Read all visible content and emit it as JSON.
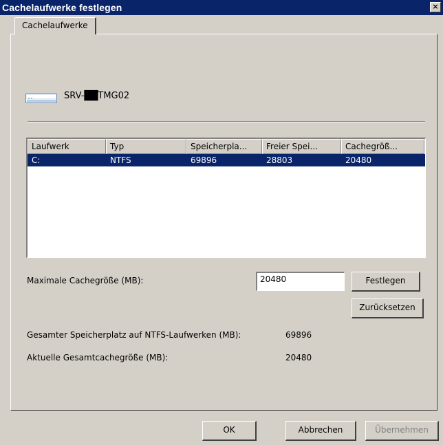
{
  "window": {
    "title": "Cachelaufwerke festlegen",
    "close_glyph": "×"
  },
  "tabs": [
    {
      "label": "Cachelaufwerke"
    }
  ],
  "server": {
    "name": "SRV-██TMG02",
    "icon": "server-icon"
  },
  "drives_table": {
    "columns": [
      "Laufwerk",
      "Typ",
      "Speicherpla...",
      "Freier Spei...",
      "Cachegröß..."
    ],
    "rows": [
      {
        "laufwerk": "C:",
        "typ": "NTFS",
        "speicherplatz": "69896",
        "freier_speicher": "28803",
        "cachegroesse": "20480",
        "selected": true
      }
    ]
  },
  "max_cache": {
    "label": "Maximale Cachegröße (MB):",
    "value": "20480",
    "set_button": "Festlegen",
    "reset_button": "Zurücksetzen"
  },
  "totals": {
    "ntfs_label": "Gesamter Speicherplatz auf NTFS-Laufwerken (MB):",
    "ntfs_value": "69896",
    "cache_label": "Aktuelle Gesamtcachegröße (MB):",
    "cache_value": "20480"
  },
  "buttons": {
    "ok": "OK",
    "cancel": "Abbrechen",
    "apply": "Übernehmen"
  },
  "colors": {
    "title_bar": "#0a246a",
    "selection": "#0a246a",
    "dialog_bg": "#d4d0c8"
  }
}
